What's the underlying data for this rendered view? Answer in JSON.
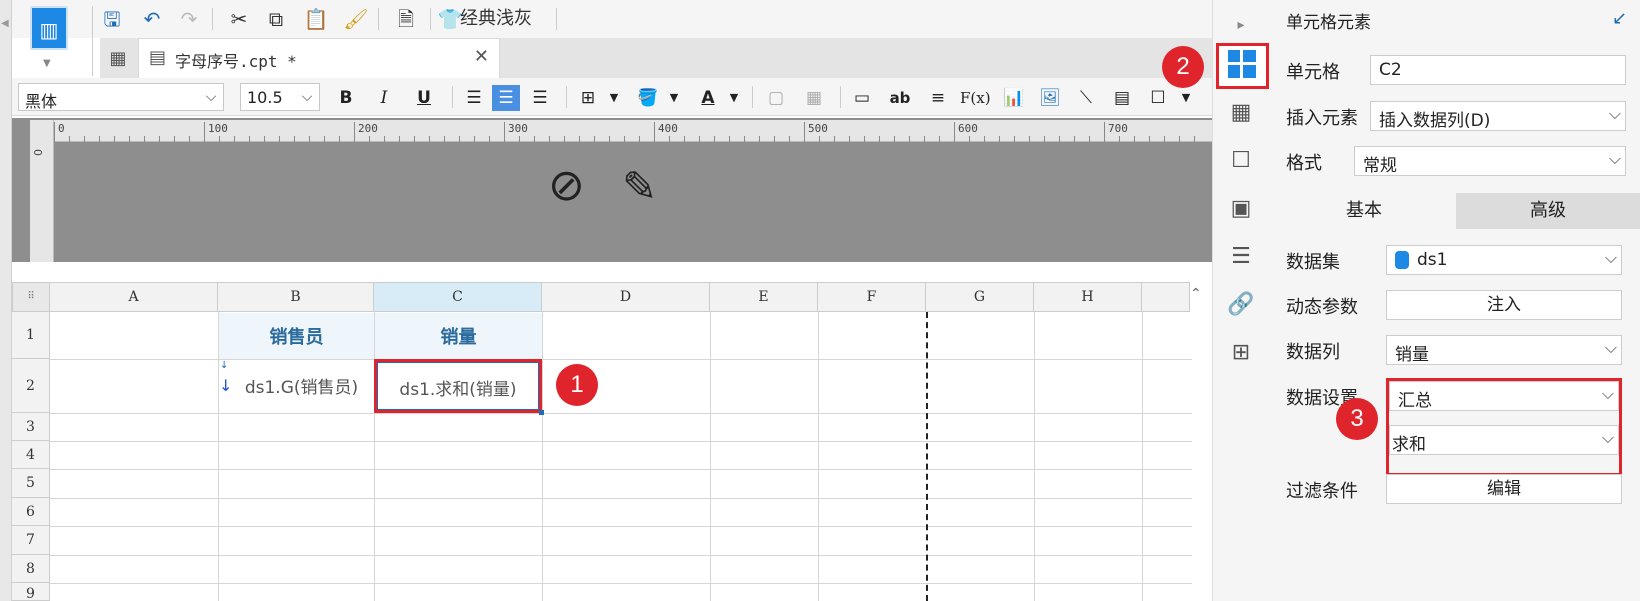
{
  "toolbar": {
    "theme_label": "经典浅灰",
    "icons": [
      "save-icon",
      "undo-icon",
      "redo-icon",
      "cut-icon",
      "copy-icon",
      "paste-icon",
      "format-painter-icon",
      "template-icon",
      "theme-icon"
    ]
  },
  "tab": {
    "title": "字母序号.cpt *",
    "close": "✕"
  },
  "format": {
    "font_name": "黑体",
    "font_size": "10.5",
    "bold": "B",
    "italic": "I",
    "underline": "U",
    "text_ab": "ab",
    "formula": "F(x)"
  },
  "ruler": {
    "labels": [
      "0",
      "100",
      "200",
      "300",
      "400",
      "500",
      "600",
      "700"
    ],
    "v_label": "0"
  },
  "sheet": {
    "columns": [
      "A",
      "B",
      "C",
      "D",
      "E",
      "F",
      "G",
      "H"
    ],
    "rows": [
      "1",
      "2",
      "3",
      "4",
      "5",
      "6",
      "7",
      "8",
      "9"
    ],
    "cells": {
      "B1": "销售员",
      "C1": "销量",
      "B2": "ds1.G(销售员)",
      "C2": "ds1.求和(销量)"
    }
  },
  "markers": {
    "m1": "1",
    "m2": "2",
    "m3": "3"
  },
  "panel": {
    "title": "单元格元素",
    "cell_label": "单元格",
    "cell_value": "C2",
    "insert_label": "插入元素",
    "insert_value": "插入数据列(D)",
    "format_label": "格式",
    "format_value": "常规",
    "tab_basic": "基本",
    "tab_advanced": "高级",
    "dataset_label": "数据集",
    "dataset_value": "ds1",
    "dynparam_label": "动态参数",
    "dynparam_button": "注入",
    "datacol_label": "数据列",
    "datacol_value": "销量",
    "datasetting_label": "数据设置",
    "datasetting_value": "汇总",
    "aggregate_value": "求和",
    "filter_label": "过滤条件",
    "filter_button": "编辑"
  },
  "colors": {
    "accent": "#1e88e5",
    "highlight": "#e0242c",
    "header_text": "#2a6a9c"
  }
}
